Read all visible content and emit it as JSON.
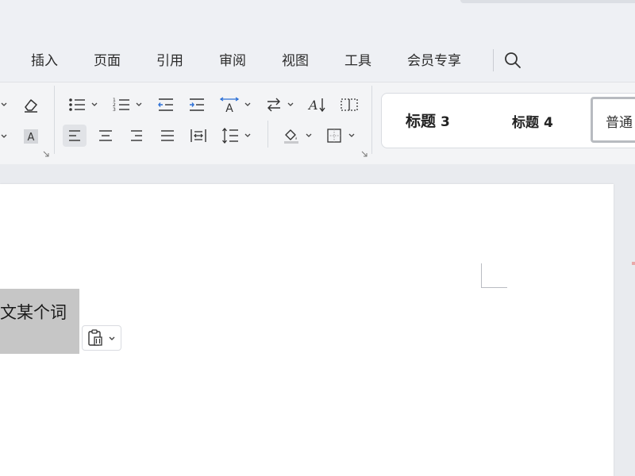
{
  "menu": {
    "tabs": [
      {
        "label": "插入"
      },
      {
        "label": "页面"
      },
      {
        "label": "引用"
      },
      {
        "label": "审阅"
      },
      {
        "label": "视图"
      },
      {
        "label": "工具"
      },
      {
        "label": "会员专享"
      }
    ]
  },
  "styles": {
    "heading3": {
      "label": "标题",
      "num": "3"
    },
    "heading4": {
      "label": "标题",
      "num": "4"
    },
    "normal": {
      "label": "普通"
    }
  },
  "document": {
    "selected_text": "文某个词"
  },
  "colors": {
    "accent": "#2b6fd6",
    "selection": "#c6c6c6"
  }
}
